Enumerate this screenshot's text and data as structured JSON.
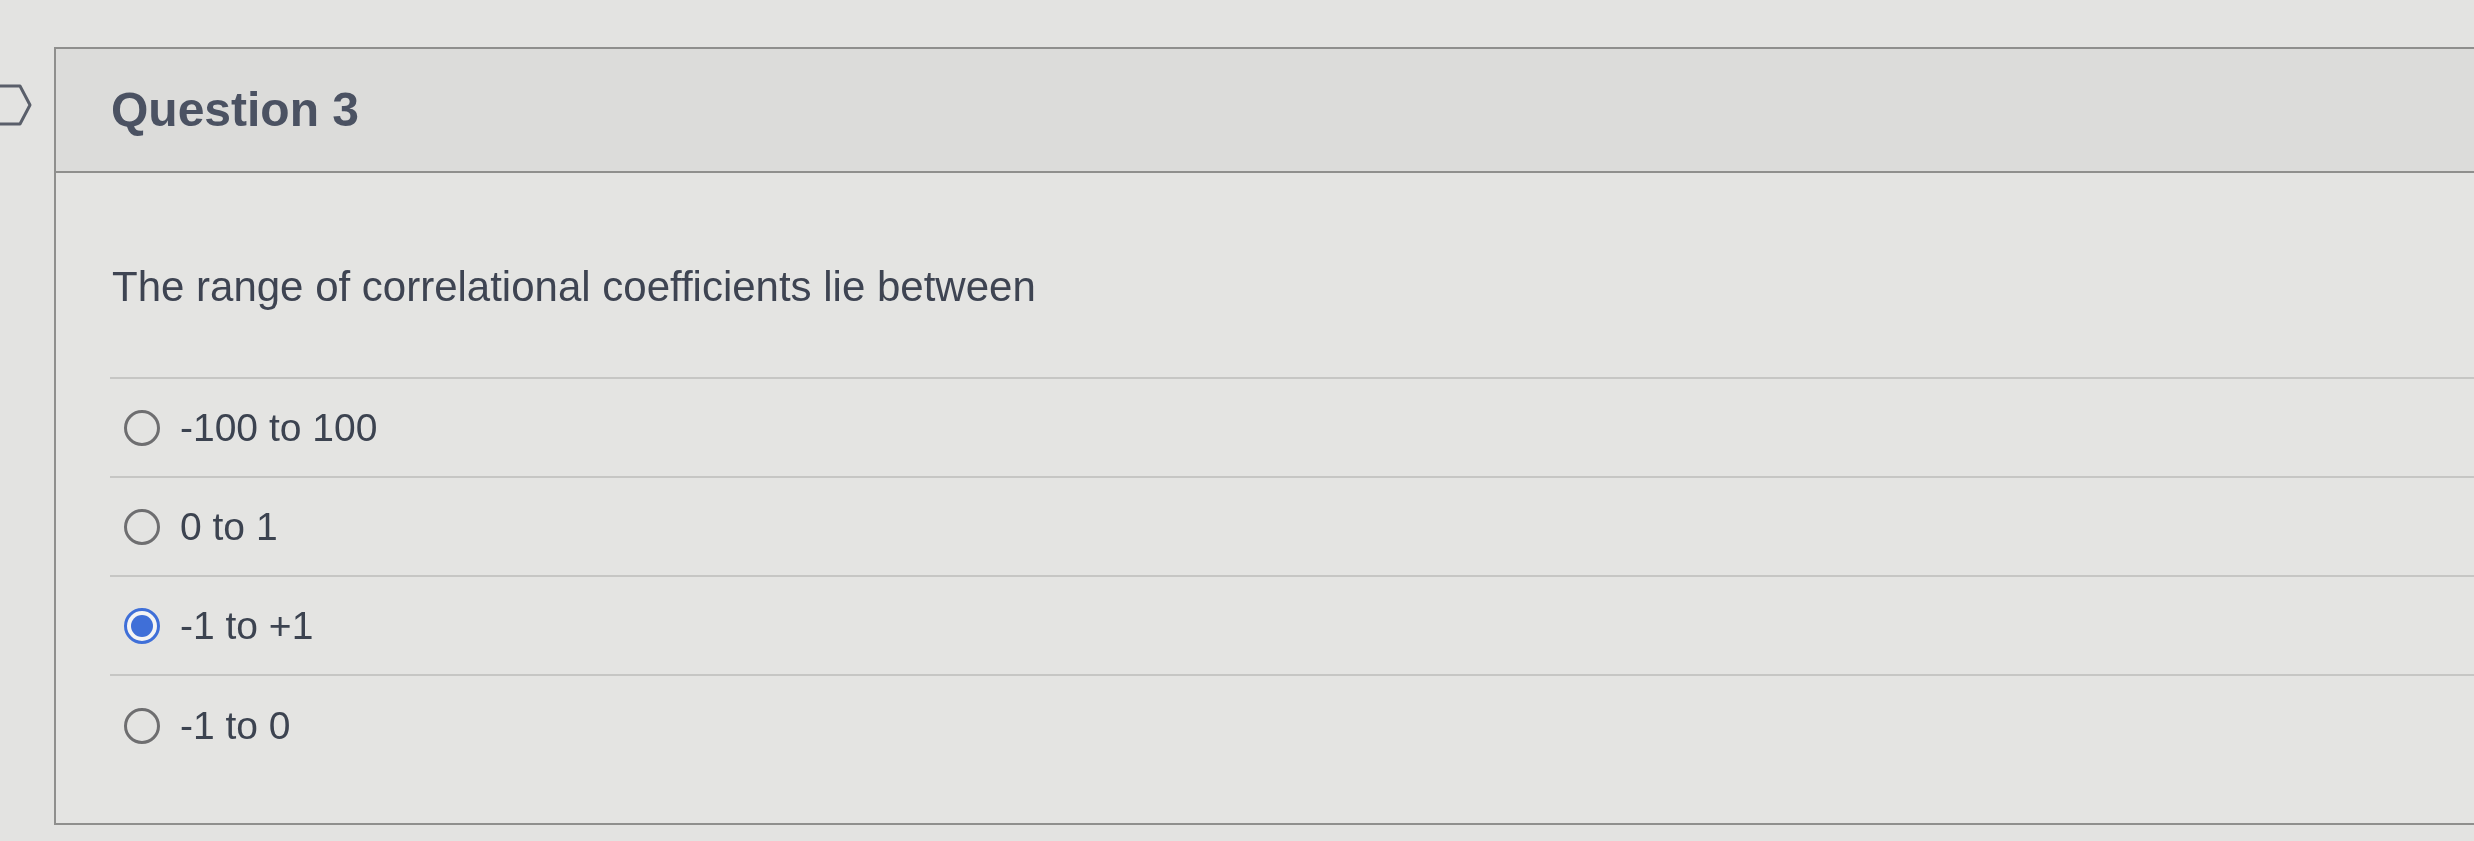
{
  "question": {
    "title": "Question 3",
    "text": "The range of correlational coefficients lie between"
  },
  "answers": [
    {
      "label": "-100 to 100",
      "selected": false
    },
    {
      "label": "0 to 1",
      "selected": false
    },
    {
      "label": "-1 to +1",
      "selected": true
    },
    {
      "label": "-1 to 0",
      "selected": false
    }
  ]
}
